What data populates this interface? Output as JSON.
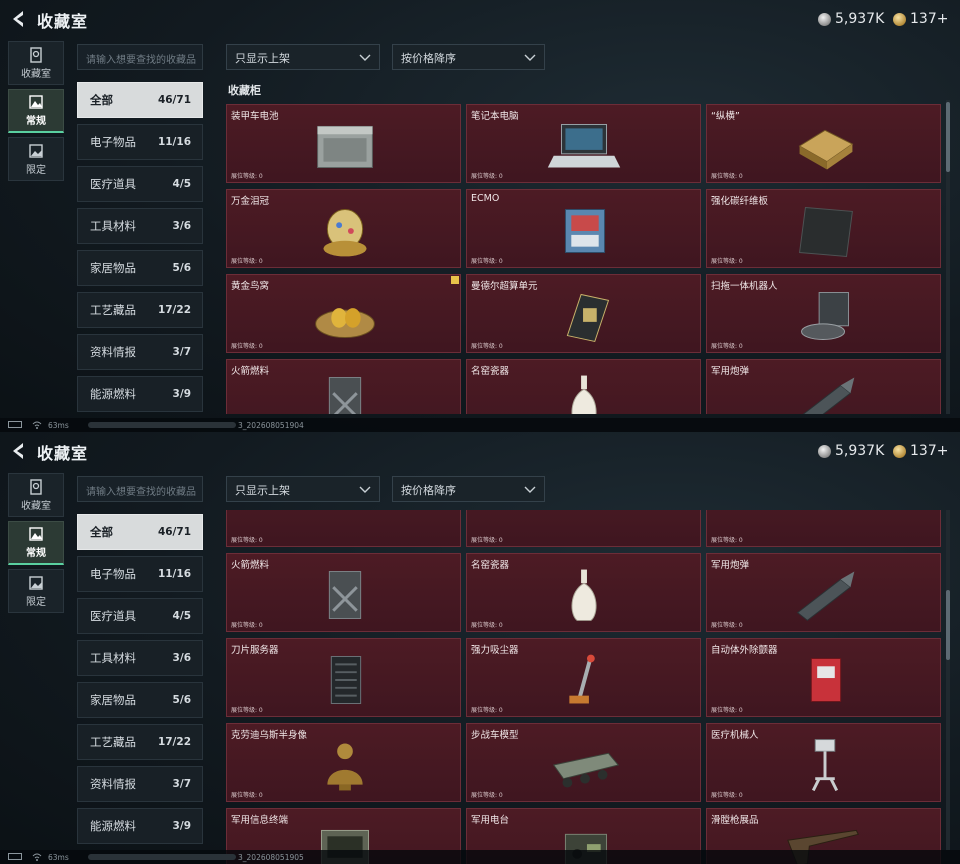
{
  "app": {
    "title": "收藏室",
    "currency": {
      "silver": "5,937K",
      "gold": "137+"
    }
  },
  "nav": [
    {
      "label": "收藏室",
      "icon": "vault-icon"
    },
    {
      "label": "常规",
      "icon": "picture-icon",
      "active": true
    },
    {
      "label": "限定",
      "icon": "picture-limited-icon"
    }
  ],
  "search": {
    "placeholder": "请输入想要查找的收藏品"
  },
  "filters": {
    "availability": "只显示上架",
    "sort": "按价格降序"
  },
  "categories": [
    {
      "label": "全部",
      "count": "46/71",
      "active": true
    },
    {
      "label": "电子物品",
      "count": "11/16"
    },
    {
      "label": "医疗道具",
      "count": "4/5"
    },
    {
      "label": "工具材料",
      "count": "3/6"
    },
    {
      "label": "家居物品",
      "count": "5/6"
    },
    {
      "label": "工艺藏品",
      "count": "17/22"
    },
    {
      "label": "资料情报",
      "count": "3/7"
    },
    {
      "label": "能源燃料",
      "count": "3/9"
    }
  ],
  "section_title": "收藏柜",
  "level_label": "展位等级: 0",
  "screen1_items": [
    {
      "name": "装甲车电池",
      "icon": "battery-icon"
    },
    {
      "name": "笔记本电脑",
      "icon": "laptop-icon"
    },
    {
      "name": "“纵横”",
      "icon": "chessboard-icon"
    },
    {
      "name": "万金泪冠",
      "icon": "jeweled-egg-icon"
    },
    {
      "name": "ECMO",
      "icon": "ecmo-machine-icon"
    },
    {
      "name": "强化碳纤维板",
      "icon": "carbon-plate-icon"
    },
    {
      "name": "黄金鸟窝",
      "icon": "golden-nest-icon",
      "badge": true
    },
    {
      "name": "曼德尔超算单元",
      "icon": "computing-unit-icon"
    },
    {
      "name": "扫拖一体机器人",
      "icon": "robot-vacuum-icon"
    },
    {
      "name": "火箭燃料",
      "icon": "fuel-can-icon"
    },
    {
      "name": "名窑瓷器",
      "icon": "porcelain-vase-icon"
    },
    {
      "name": "军用炮弹",
      "icon": "artillery-shell-icon"
    }
  ],
  "screen2_items": [
    {
      "name": "火箭燃料",
      "icon": "fuel-can-icon"
    },
    {
      "name": "名窑瓷器",
      "icon": "porcelain-vase-icon"
    },
    {
      "name": "军用炮弹",
      "icon": "artillery-shell-icon"
    },
    {
      "name": "刀片服务器",
      "icon": "blade-server-icon"
    },
    {
      "name": "强力吸尘器",
      "icon": "vacuum-cleaner-icon"
    },
    {
      "name": "自动体外除颤器",
      "icon": "defibrillator-icon"
    },
    {
      "name": "克劳迪乌斯半身像",
      "icon": "bust-statue-icon"
    },
    {
      "name": "步战车模型",
      "icon": "ifv-model-icon"
    },
    {
      "name": "医疗机械人",
      "icon": "medical-robot-icon"
    },
    {
      "name": "军用信息终端",
      "icon": "info-terminal-icon"
    },
    {
      "name": "军用电台",
      "icon": "military-radio-icon"
    },
    {
      "name": "滑膛枪展品",
      "icon": "musket-icon"
    }
  ],
  "status": {
    "ping": "63ms",
    "build1": "3_202608051904",
    "build2": "3_202608051905"
  }
}
